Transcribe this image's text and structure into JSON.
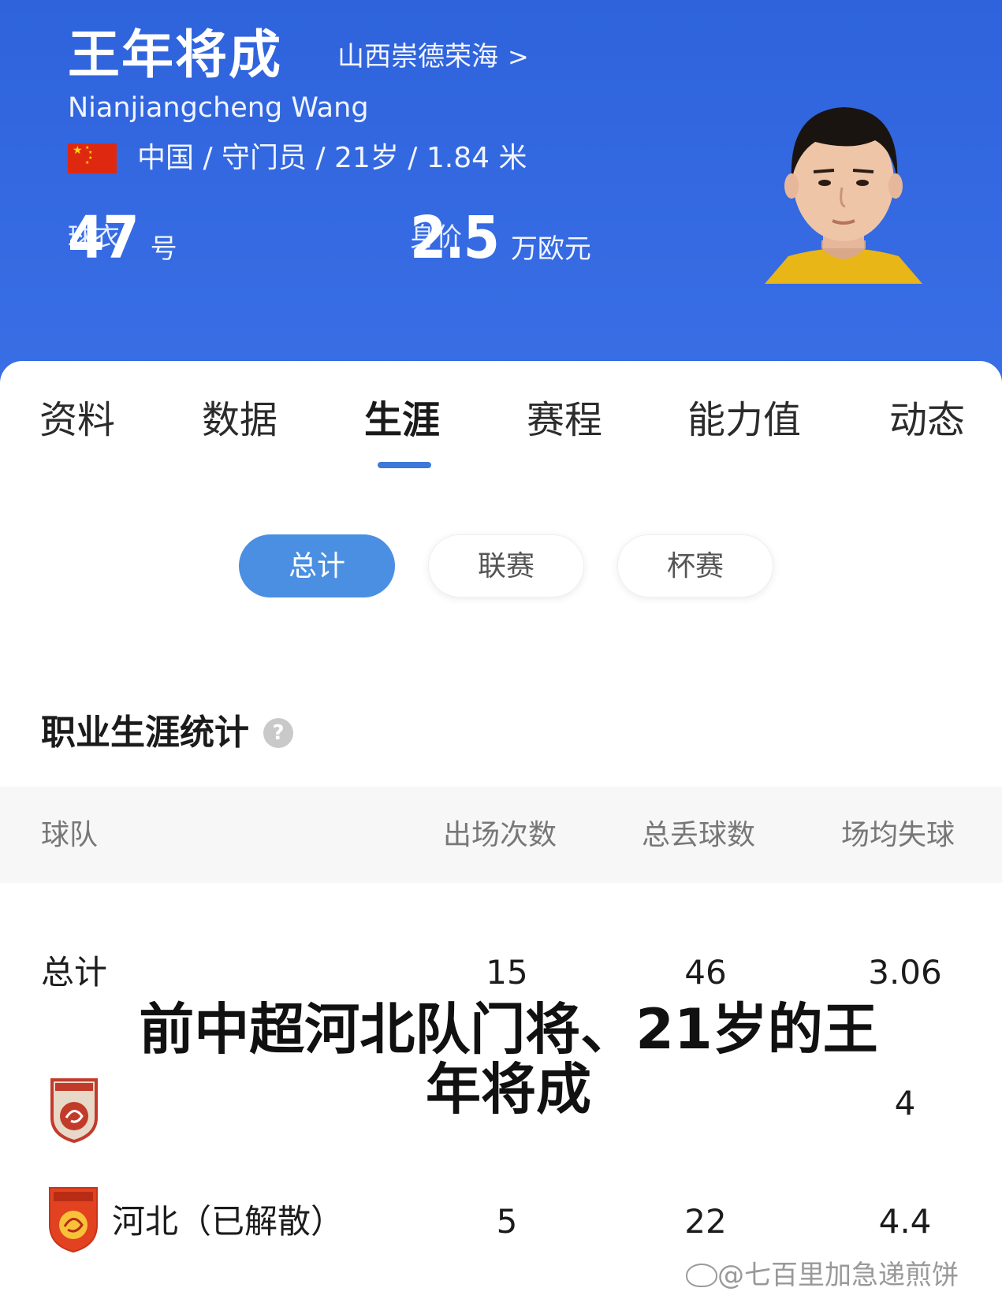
{
  "header": {
    "name_cn": "王年将成",
    "club_link": "山西崇德荣海",
    "club_chevron": ">",
    "name_en": "Nianjiangcheng Wang",
    "meta": "中国 / 守门员 / 21岁 / 1.84 米",
    "jersey": {
      "value": "47",
      "unit": "号",
      "caption": "球衣"
    },
    "market_value": {
      "value": "2.5",
      "unit": "万欧元",
      "caption": "身价"
    },
    "colors": {
      "banner": "#2e63dc",
      "accent": "#3e78d8"
    }
  },
  "tabs": [
    "资料",
    "数据",
    "生涯",
    "赛程",
    "能力值",
    "动态"
  ],
  "active_tab": "生涯",
  "filters": [
    "总计",
    "联赛",
    "杯赛"
  ],
  "active_filter": "总计",
  "section": {
    "title": "职业生涯统计",
    "help_icon": "question-circle-icon"
  },
  "table": {
    "headers": [
      "球队",
      "出场次数",
      "总丢球数",
      "场均失球"
    ],
    "rows": [
      {
        "team": "总计",
        "apps": "15",
        "conceded": "46",
        "avg": "3.06"
      },
      {
        "team": "",
        "apps": "",
        "conceded": "",
        "avg": "4"
      },
      {
        "team": "河北（已解散）",
        "apps": "5",
        "conceded": "22",
        "avg": "4.4"
      }
    ]
  },
  "overlay_caption": "前中超河北队门将、21岁的王年将成",
  "watermark": "@七百里加急递煎饼"
}
